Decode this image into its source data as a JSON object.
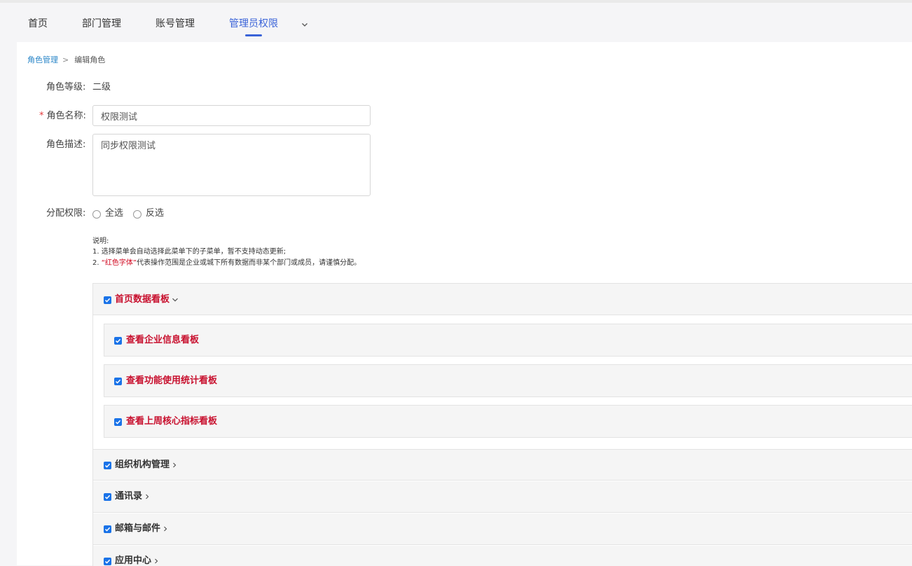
{
  "nav": {
    "items": [
      {
        "label": "首页"
      },
      {
        "label": "部门管理"
      },
      {
        "label": "账号管理"
      },
      {
        "label": "管理员权限"
      }
    ],
    "active_index": 3
  },
  "breadcrumb": {
    "link": "角色管理",
    "separator": ">",
    "current": "编辑角色"
  },
  "form": {
    "level_label": "角色等级:",
    "level_value": "二级",
    "name_label": "角色名称:",
    "name_required_mark": "*",
    "name_value": "权限测试",
    "desc_label": "角色描述:",
    "desc_value": "同步权限测试",
    "assign_label": "分配权限:",
    "select_all": "全选",
    "invert": "反选"
  },
  "notes": {
    "title": "说明:",
    "line1": "1. 选择菜单会自动选择此菜单下的子菜单，暂不支持动态更新;",
    "line2_prefix": "2. ",
    "line2_red": "“红色字体”",
    "line2_rest": "代表操作范围是企业或城下所有数据而非某个部门或成员，请谨慎分配。"
  },
  "permissions": {
    "group1": {
      "label": "首页数据看板",
      "expanded": true,
      "checked": true
    },
    "children": [
      {
        "label": "查看企业信息看板",
        "checked": true
      },
      {
        "label": "查看功能使用统计看板",
        "checked": true
      },
      {
        "label": "查看上周核心指标看板",
        "checked": true
      }
    ],
    "groups": [
      {
        "label": "组织机构管理",
        "checked": true
      },
      {
        "label": "通讯录",
        "checked": true
      },
      {
        "label": "邮箱与邮件",
        "checked": true
      },
      {
        "label": "应用中心",
        "checked": true
      }
    ]
  },
  "colors": {
    "accent": "#3a63d8",
    "link": "#2a86c8",
    "danger_text": "#c8102e",
    "checkbox": "#1a73e8"
  }
}
